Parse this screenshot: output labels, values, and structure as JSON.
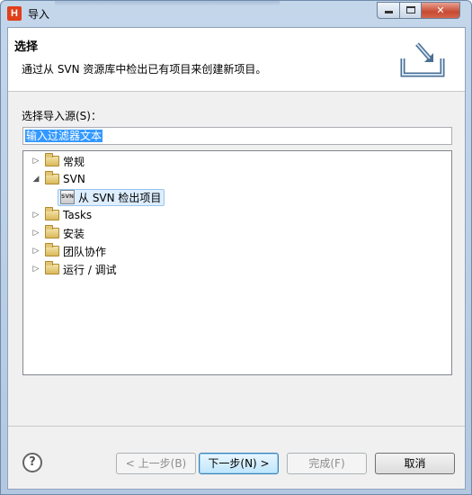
{
  "window": {
    "title": "导入",
    "app_icon_letter": "H"
  },
  "header": {
    "title": "选择",
    "description": "通过从 SVN 资源库中检出已有项目来创建新项目。"
  },
  "source": {
    "label": "选择导入源(S)：",
    "filter_value": "输入过滤器文本"
  },
  "tree": {
    "items": [
      {
        "label": "常规",
        "expanded": false
      },
      {
        "label": "SVN",
        "expanded": true
      },
      {
        "label": "从 SVN 检出项目",
        "selected": true
      },
      {
        "label": "Tasks",
        "expanded": false
      },
      {
        "label": "安装",
        "expanded": false
      },
      {
        "label": "团队协作",
        "expanded": false
      },
      {
        "label": "运行 / 调试",
        "expanded": false
      }
    ]
  },
  "buttons": {
    "back": "< 上一步(B)",
    "next": "下一步(N) >",
    "finish": "完成(F)",
    "cancel": "取消"
  },
  "icons": {
    "help": "?",
    "svn_badge": "SVN",
    "close": "✕"
  },
  "colors": {
    "selection": "#3399ff",
    "default_button": "#bee6fd",
    "close_button": "#c74a32"
  }
}
